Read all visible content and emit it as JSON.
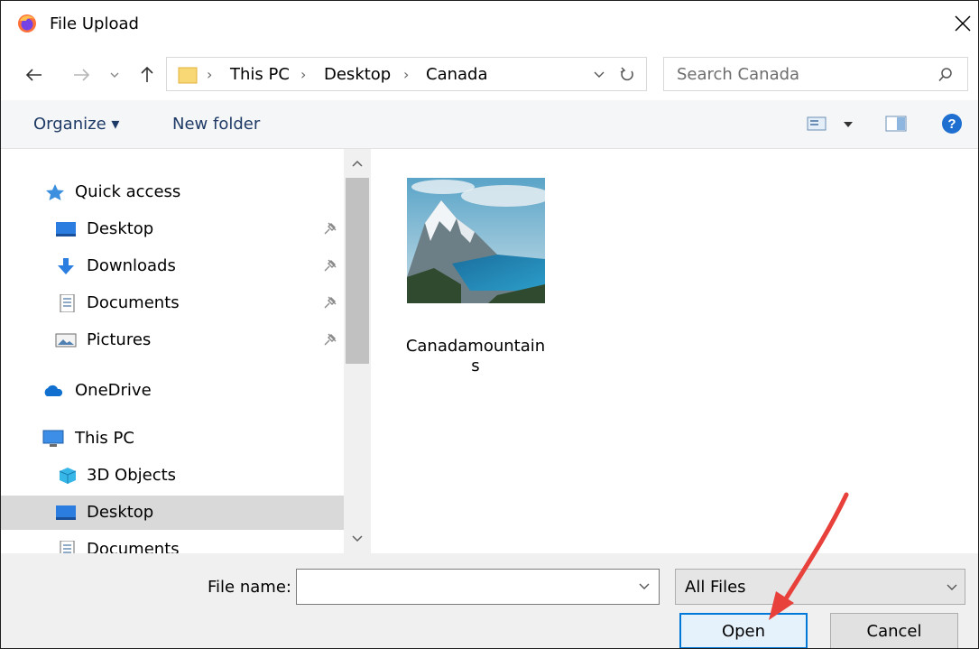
{
  "window": {
    "title": "File Upload"
  },
  "address": {
    "crumbs": [
      "This PC",
      "Desktop",
      "Canada"
    ]
  },
  "search": {
    "placeholder": "Search Canada"
  },
  "toolbar": {
    "organize": "Organize ▾",
    "new_folder": "New folder"
  },
  "tree": {
    "quick_access": "Quick access",
    "desktop": "Desktop",
    "downloads": "Downloads",
    "documents": "Documents",
    "pictures": "Pictures",
    "onedrive": "OneDrive",
    "this_pc": "This PC",
    "objects3d": "3D Objects",
    "desktop2": "Desktop",
    "documents2": "Documents"
  },
  "files": [
    {
      "name": "Canadamountains"
    }
  ],
  "bottom": {
    "file_name_label": "File name:",
    "file_name_value": "",
    "filter": "All Files",
    "open": "Open",
    "cancel": "Cancel"
  },
  "colors": {
    "accent": "#0078d7",
    "annotation_arrow": "#e8403a",
    "toolbar_text": "#1e3a66"
  }
}
